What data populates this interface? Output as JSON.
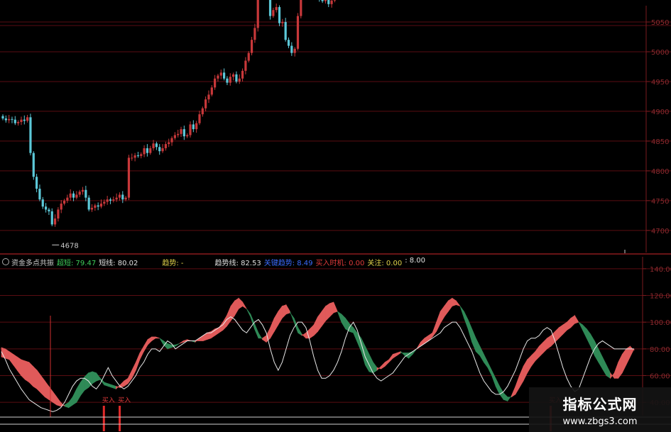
{
  "window": {
    "title": ""
  },
  "colors": {
    "up": "#c8383a",
    "down": "#5cc8d8",
    "fill_up": "#e05a5a",
    "fill_down": "#2f8a57",
    "white": "#e8e8e8",
    "grid": "#5a0d12",
    "axis": "#7a1a1e"
  },
  "indicator_legend": {
    "name": "资金多点共振",
    "items": [
      {
        "label": "超短",
        "value": "79.47",
        "color": "#3ecf5a"
      },
      {
        "label": "短线",
        "value": "80.02",
        "color": "#e0e0e0"
      },
      {
        "label": "趋势",
        "value": "-",
        "color": "#e0d24a"
      },
      {
        "label": "趋势线",
        "value": "82.53",
        "color": "#e0e0e0"
      },
      {
        "label": "关键趋势",
        "value": "8.49",
        "color": "#3a6cff"
      },
      {
        "label": "买入时机",
        "value": "0.00",
        "color": "#e03a3a"
      },
      {
        "label": "关注",
        "value": "0.00",
        "color": "#e0d24a"
      },
      {
        "label": "",
        "value": "8.00",
        "color": "#e0e0e0"
      }
    ]
  },
  "chart_data": [
    {
      "type": "candlestick",
      "title": "",
      "yticks": [
        4700,
        4750,
        4800,
        4850,
        4900,
        4950,
        5000,
        5050
      ],
      "ylim": [
        4670,
        5075
      ],
      "annotations": [
        {
          "text": "4678",
          "type": "low-marker"
        }
      ],
      "grid": true,
      "close": [
        4888,
        4885,
        4887,
        4886,
        4880,
        4882,
        4886,
        4884,
        4890,
        4830,
        4790,
        4770,
        4752,
        4740,
        4735,
        4732,
        4710,
        4720,
        4735,
        4745,
        4750,
        4755,
        4762,
        4755,
        4760,
        4765,
        4768,
        4755,
        4735,
        4738,
        4742,
        4740,
        4745,
        4748,
        4752,
        4750,
        4752,
        4755,
        4760,
        4752,
        4755,
        4822,
        4822,
        4826,
        4825,
        4828,
        4838,
        4830,
        4838,
        4846,
        4840,
        4833,
        4838,
        4845,
        4848,
        4855,
        4860,
        4862,
        4870,
        4858,
        4860,
        4878,
        4870,
        4880,
        4895,
        4905,
        4920,
        4928,
        4940,
        4955,
        4960,
        4965,
        4955,
        4948,
        4958,
        4962,
        4950,
        4955,
        4968,
        4985,
        4998,
        5020,
        5040,
        5090,
        5130,
        5150,
        5110,
        5060,
        5070,
        5075,
        5048,
        5050,
        5020,
        5010,
        4998,
        5005,
        5060,
        5120,
        5150,
        5135,
        5128,
        5120,
        5098,
        5090,
        5085,
        5092,
        5080,
        5086,
        5100,
        5095,
        5098,
        5105,
        5118,
        5100,
        5110,
        5112,
        5115,
        5110,
        5118,
        5125,
        5130,
        5125,
        5135
      ],
      "open_offset_pattern": "derived"
    },
    {
      "type": "line",
      "title": "",
      "yticks": [
        40,
        60,
        80,
        100,
        120,
        140
      ],
      "ylim": [
        30,
        150
      ],
      "grid": true,
      "series": [
        {
          "name": "超短",
          "values": [
            81,
            80,
            78,
            76,
            74,
            72,
            71,
            70,
            67,
            64,
            60,
            56,
            52,
            48,
            44,
            40,
            37,
            36,
            38,
            40,
            45,
            49,
            51,
            54,
            56,
            57,
            53,
            52,
            51,
            50,
            53,
            56,
            58,
            64,
            70,
            77,
            82,
            87,
            89,
            89,
            88,
            83,
            80,
            81,
            82,
            84,
            86,
            87,
            86,
            85,
            88,
            90,
            92,
            93,
            95,
            96,
            100,
            105,
            112,
            116,
            118,
            115,
            110,
            104,
            95,
            88,
            88,
            90,
            96,
            103,
            108,
            112,
            113,
            108,
            100,
            92,
            90,
            92,
            95,
            98,
            104,
            108,
            112,
            114,
            115,
            108,
            100,
            95,
            93,
            92,
            85,
            78,
            68,
            63,
            62,
            64,
            67,
            70,
            72,
            76,
            77,
            78,
            75,
            73,
            76,
            80,
            85,
            88,
            90,
            92,
            100,
            108,
            112,
            116,
            118,
            116,
            112,
            103,
            95,
            85,
            78,
            75,
            70,
            66,
            60,
            52,
            46,
            42,
            41,
            45,
            52,
            60,
            67,
            72,
            75,
            78,
            82,
            85,
            88,
            90,
            93,
            96,
            98,
            100,
            103,
            105,
            100,
            94,
            88,
            82,
            75,
            70,
            65,
            60,
            58,
            62,
            70,
            76,
            80,
            82,
            79
          ]
        },
        {
          "name": "短线",
          "values": [
            74,
            73,
            72,
            68,
            64,
            60,
            57,
            55,
            52,
            50,
            47,
            44,
            42,
            40,
            38,
            37,
            38,
            40,
            44,
            50,
            55,
            59,
            62,
            63,
            62,
            58,
            55,
            54,
            53,
            52,
            51,
            52,
            54,
            58,
            64,
            72,
            78,
            83,
            86,
            88,
            88,
            86,
            84,
            83,
            83,
            84,
            85,
            86,
            86,
            86,
            86,
            86,
            87,
            88,
            90,
            92,
            94,
            97,
            101,
            105,
            110,
            112,
            110,
            106,
            99,
            92,
            87,
            85,
            88,
            93,
            98,
            103,
            106,
            107,
            103,
            96,
            91,
            88,
            88,
            90,
            93,
            97,
            101,
            104,
            107,
            108,
            106,
            103,
            99,
            96,
            92,
            88,
            82,
            76,
            70,
            66,
            65,
            67,
            70,
            73,
            75,
            77,
            77,
            77,
            78,
            80,
            82,
            84,
            86,
            89,
            93,
            99,
            104,
            108,
            112,
            113,
            112,
            108,
            102,
            95,
            88,
            82,
            76,
            70,
            64,
            58,
            52,
            47,
            44,
            44,
            46,
            51,
            56,
            62,
            67,
            71,
            74,
            77,
            80,
            82,
            85,
            88,
            91,
            94,
            96,
            99,
            100,
            98,
            95,
            91,
            86,
            80,
            74,
            68,
            62,
            58,
            58,
            62,
            68,
            74,
            80
          ]
        },
        {
          "name": "白线",
          "values": [
            78,
            72,
            65,
            60,
            55,
            50,
            46,
            42,
            40,
            38,
            36,
            35,
            34,
            33,
            34,
            36,
            40,
            46,
            52,
            56,
            58,
            58,
            56,
            52,
            50,
            54,
            60,
            66,
            60,
            56,
            52,
            50,
            52,
            56,
            60,
            66,
            70,
            76,
            80,
            80,
            78,
            82,
            86,
            84,
            80,
            82,
            84,
            86,
            86,
            86,
            88,
            90,
            92,
            92,
            94,
            96,
            98,
            102,
            104,
            102,
            98,
            94,
            92,
            96,
            100,
            102,
            98,
            92,
            80,
            70,
            64,
            70,
            80,
            90,
            96,
            100,
            100,
            96,
            86,
            74,
            64,
            58,
            58,
            60,
            64,
            70,
            78,
            88,
            96,
            100,
            94,
            84,
            74,
            68,
            62,
            58,
            56,
            58,
            60,
            62,
            66,
            70,
            74,
            76,
            78,
            80,
            82,
            84,
            86,
            88,
            90,
            92,
            96,
            98,
            100,
            100,
            96,
            90,
            84,
            78,
            70,
            62,
            56,
            52,
            48,
            46,
            46,
            48,
            52,
            58,
            64,
            72,
            80,
            86,
            88,
            88,
            90,
            94,
            96,
            94,
            86,
            76,
            66,
            58,
            52,
            48,
            50,
            58,
            66,
            74,
            80,
            84,
            86,
            84,
            82,
            80,
            80,
            80,
            80,
            80,
            80
          ]
        },
        {
          "name": "买入信号",
          "type": "bar-marks",
          "labels": [
            "买入",
            "买入",
            "买入"
          ],
          "x_index": [
            26,
            30,
            139
          ]
        }
      ]
    }
  ],
  "watermark": {
    "title": "指标公式网",
    "url": "www.zbgs3.com"
  }
}
